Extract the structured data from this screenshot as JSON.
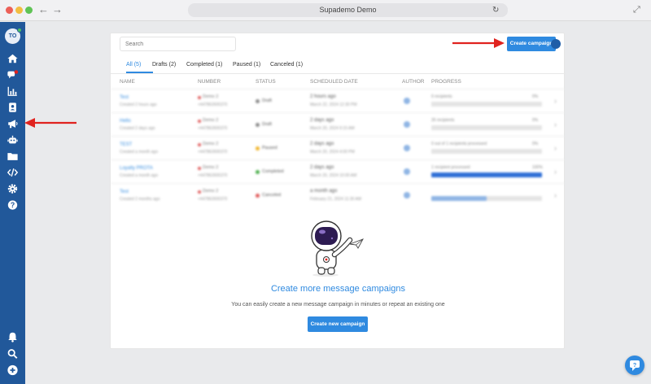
{
  "browser": {
    "title": "Supademo Demo",
    "back_icon": "arrow-left-icon",
    "forward_icon": "arrow-right-icon",
    "reload_icon": "reload-icon",
    "expand_icon": "expand-icon"
  },
  "sidebar": {
    "avatar_initials": "TO",
    "items": [
      {
        "icon": "home-icon"
      },
      {
        "icon": "chat-bubbles-icon"
      },
      {
        "icon": "bar-chart-icon"
      },
      {
        "icon": "contact-book-icon"
      },
      {
        "icon": "megaphone-icon"
      },
      {
        "icon": "robot-icon"
      },
      {
        "icon": "folder-icon"
      },
      {
        "icon": "code-icon"
      },
      {
        "icon": "gear-icon"
      },
      {
        "icon": "help-icon"
      }
    ],
    "bottom_items": [
      {
        "icon": "bell-icon"
      },
      {
        "icon": "search-icon"
      },
      {
        "icon": "plus-circle-icon"
      }
    ]
  },
  "toolbar": {
    "search_placeholder": "Search",
    "create_campaign_label": "Create campaign"
  },
  "tabs": [
    {
      "label": "All (5)",
      "active": true
    },
    {
      "label": "Drafts (2)",
      "active": false
    },
    {
      "label": "Completed (1)",
      "active": false
    },
    {
      "label": "Paused (1)",
      "active": false
    },
    {
      "label": "Canceled (1)",
      "active": false
    }
  ],
  "table": {
    "headers": [
      "NAME",
      "NUMBER",
      "STATUS",
      "SCHEDULED DATE",
      "AUTHOR",
      "PROGRESS"
    ],
    "rows": [
      {
        "name": "Test",
        "created": "Created 2 hours ago",
        "number": "Demo 2",
        "number_sub": "+447862600370",
        "status": "Draft",
        "status_color": "#8a8a8a",
        "date": "2 hours ago",
        "date_sub": "March 22, 2024 12:30 PM",
        "progress_text": "0 recipients",
        "progress_pct": "0%",
        "progress": 0
      },
      {
        "name": "Hello",
        "created": "Created 2 days ago",
        "number": "Demo 2",
        "number_sub": "+447862600370",
        "status": "Draft",
        "status_color": "#8a8a8a",
        "date": "2 days ago",
        "date_sub": "March 20, 2024 9:15 AM",
        "progress_text": "26 recipients",
        "progress_pct": "0%",
        "progress": 0
      },
      {
        "name": "TEST",
        "created": "Created a month ago",
        "number": "Demo 2",
        "number_sub": "+447862600370",
        "status": "Paused",
        "status_color": "#f0b429",
        "date": "2 days ago",
        "date_sub": "March 20, 2024 4:00 PM",
        "progress_text": "0 out of 1 recipients processed",
        "progress_pct": "0%",
        "progress": 0
      },
      {
        "name": "Loyalty PROTA",
        "created": "Created a month ago",
        "number": "Demo 2",
        "number_sub": "+447862600370",
        "status": "Completed",
        "status_color": "#4cae4c",
        "date": "2 days ago",
        "date_sub": "March 20, 2024 10:00 AM",
        "progress_text": "1 recipient processed",
        "progress_pct": "100%",
        "progress": 1.0
      },
      {
        "name": "Test",
        "created": "Created 2 months ago",
        "number": "Demo 2",
        "number_sub": "+447862600370",
        "status": "Canceled",
        "status_color": "#e05a5a",
        "date": "a month ago",
        "date_sub": "February 21, 2024 11:30 AM",
        "progress_text": "",
        "progress_pct": "",
        "progress": 0.5
      }
    ]
  },
  "empty_state": {
    "title": "Create more message campaigns",
    "subtitle": "You can easily create a new message campaign in minutes or repeat an existing one",
    "button_label": "Create new campaign"
  },
  "colors": {
    "sidebar": "#21589a",
    "accent": "#2f8ae0",
    "annotation_arrow": "#e0231f"
  }
}
